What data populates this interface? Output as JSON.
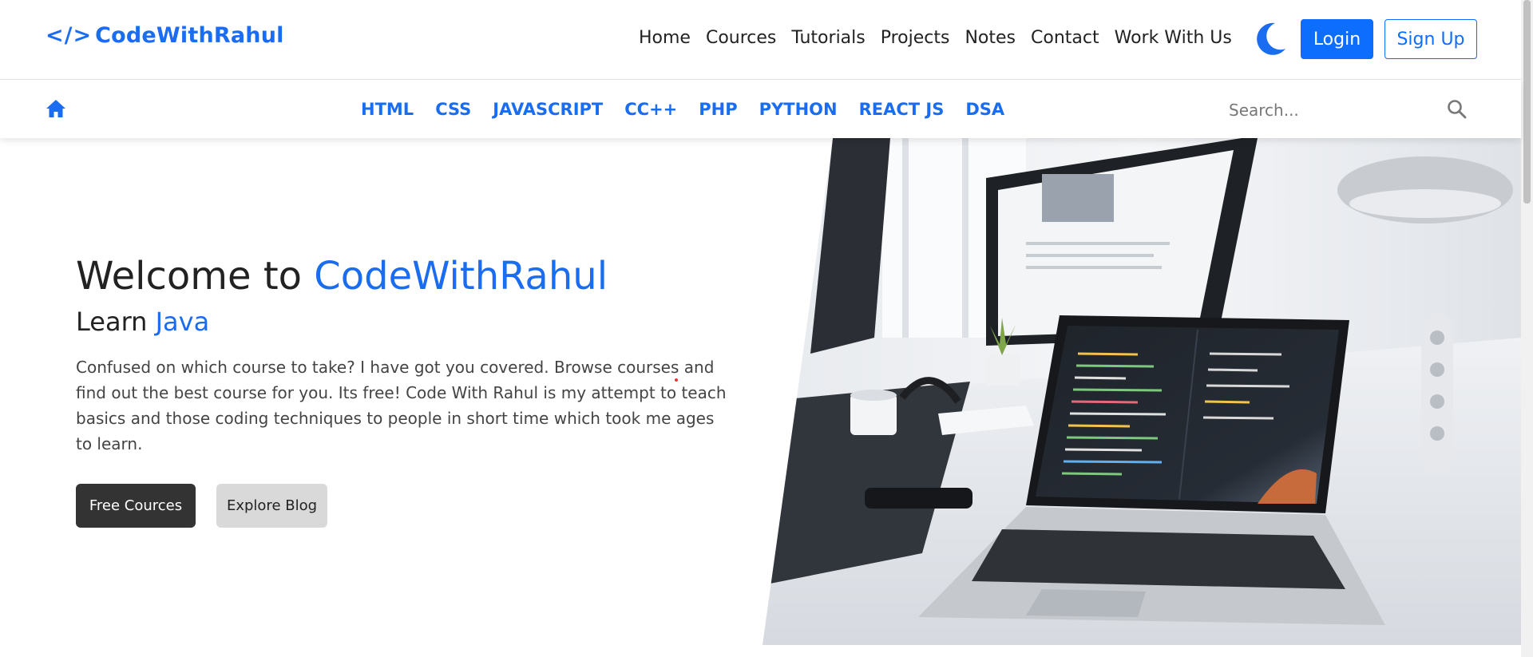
{
  "brand": {
    "icon": "code-brackets-icon",
    "icon_glyph": "</>",
    "name": "CodeWithRahul"
  },
  "nav": {
    "links": [
      "Home",
      "Cources",
      "Tutorials",
      "Projects",
      "Notes",
      "Contact",
      "Work With Us"
    ],
    "theme_toggle_icon": "moon-icon",
    "login_label": "Login",
    "signup_label": "Sign Up"
  },
  "subnav": {
    "home_icon": "home-icon",
    "languages": [
      "HTML",
      "CSS",
      "JAVASCRIPT",
      "CC++",
      "PHP",
      "PYTHON",
      "REACT JS",
      "DSA"
    ],
    "search_placeholder": "Search...",
    "search_icon": "search-icon"
  },
  "hero": {
    "title_prefix": "Welcome to ",
    "title_accent": "CodeWithRahul",
    "subtitle_prefix": "Learn ",
    "subtitle_accent": "Java",
    "description": "Confused on which course to take? I have got you covered. Browse courses and find out the best course for you. Its free! Code With Rahul is my attempt to teach basics and those coding techniques to people in short time which took me ages to learn.",
    "primary_button": "Free Cources",
    "secondary_button": "Explore Blog",
    "image": "laptop-desk-photo"
  },
  "colors": {
    "accent": "#1a6cf0",
    "primary_button": "#0d6efd",
    "dark_button": "#333333",
    "light_button": "#d9d9d9"
  }
}
